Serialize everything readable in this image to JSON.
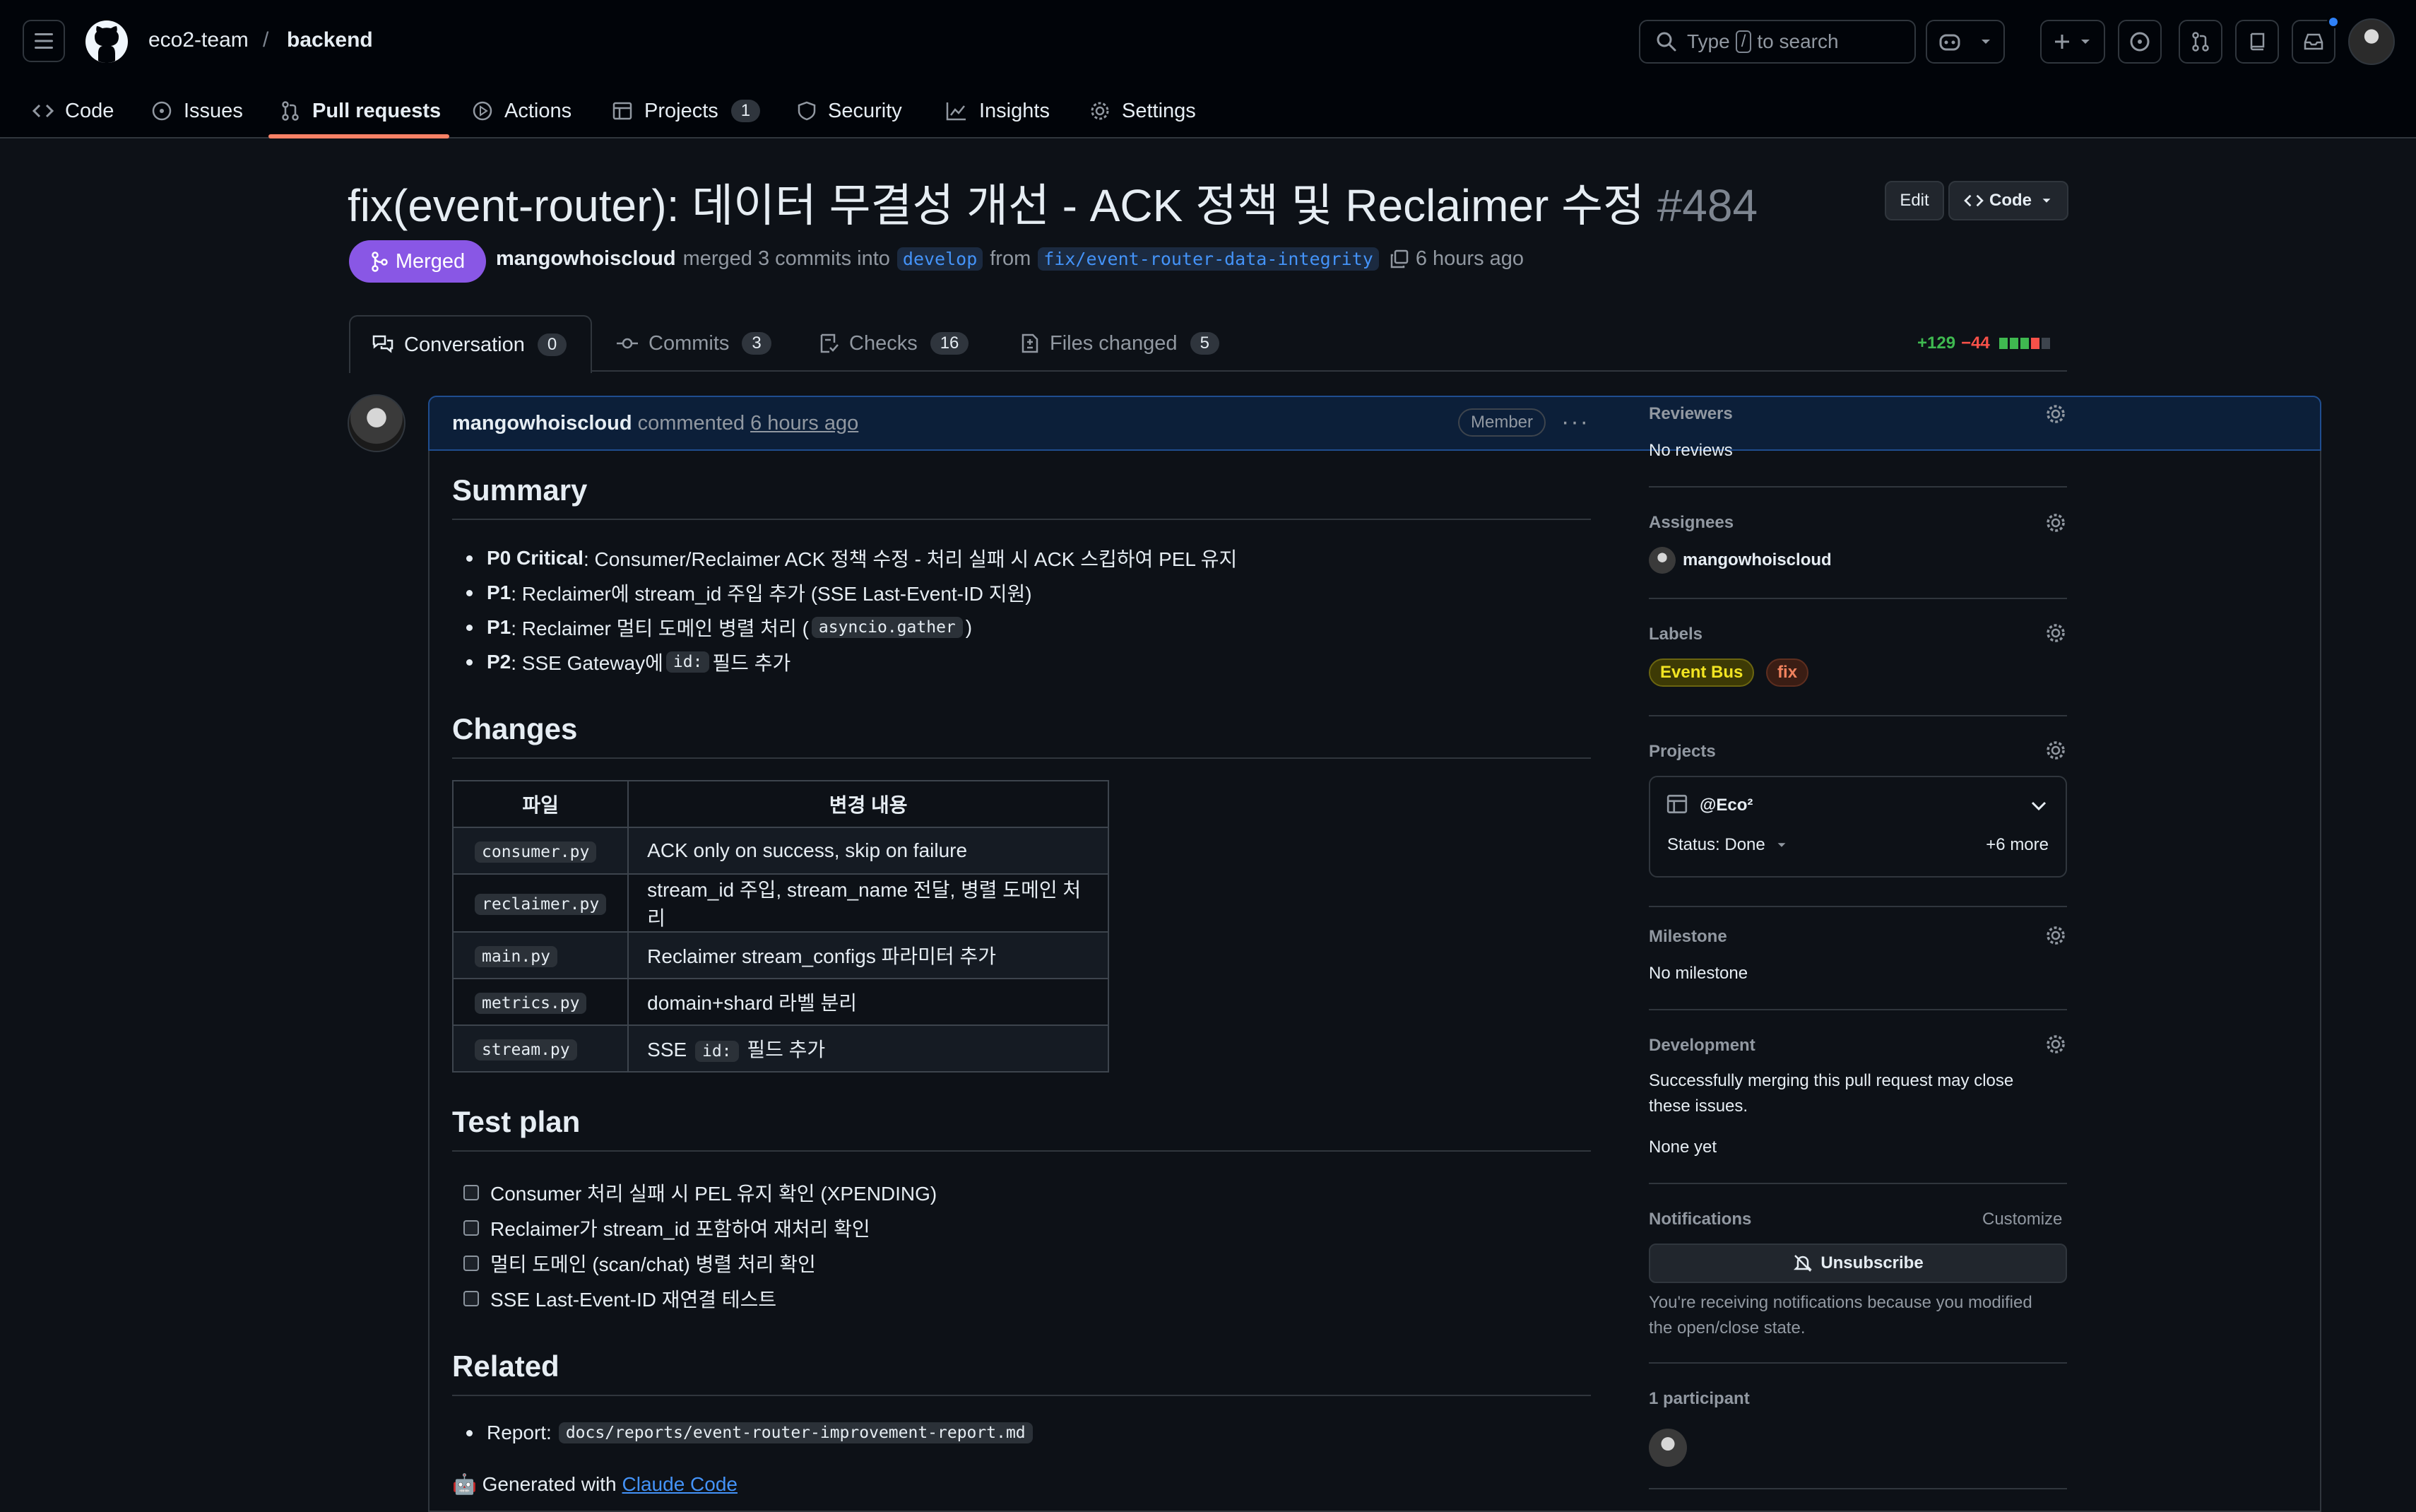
{
  "header": {
    "owner": "eco2-team",
    "separator": "/",
    "repo": "backend",
    "search_prefix": "Type",
    "search_key": "/",
    "search_suffix": "to search"
  },
  "repo_nav": [
    {
      "label": "Code"
    },
    {
      "label": "Issues"
    },
    {
      "label": "Pull requests"
    },
    {
      "label": "Actions"
    },
    {
      "label": "Projects",
      "count": "1"
    },
    {
      "label": "Security"
    },
    {
      "label": "Insights"
    },
    {
      "label": "Settings"
    }
  ],
  "pr": {
    "title": "fix(event-router): 데이터 무결성 개선 - ACK 정책 및 Reclaimer 수정",
    "number": "#484",
    "edit_label": "Edit",
    "code_label": "Code",
    "state": "Merged",
    "author": "mangowhoiscloud",
    "merged_text": "merged 3 commits into",
    "base_branch": "develop",
    "from_text": "from",
    "head_branch": "fix/event-router-data-integrity",
    "time": "6 hours ago"
  },
  "tabs": [
    {
      "label": "Conversation",
      "count": "0"
    },
    {
      "label": "Commits",
      "count": "3"
    },
    {
      "label": "Checks",
      "count": "16"
    },
    {
      "label": "Files changed",
      "count": "5"
    }
  ],
  "diffstat": {
    "additions": "+129",
    "deletions": "−44"
  },
  "colors": {
    "merged": "#8957e5",
    "link": "#4493f8",
    "add": "#3fb950",
    "del": "#f85149",
    "tab_underline": "#f78166"
  },
  "comment": {
    "author": "mangowhoiscloud",
    "action": "commented",
    "time": "6 hours ago",
    "role": "Member",
    "menu": "···",
    "summary_heading": "Summary",
    "summary": [
      {
        "prefix": "P0 Critical",
        "text": ": Consumer/Reclaimer ACK 정책 수정 - 처리 실패 시 ACK 스킵하여 PEL 유지"
      },
      {
        "prefix": "P1",
        "text": ": Reclaimer에 stream_id 주입 추가 (SSE Last-Event-ID 지원)"
      },
      {
        "prefix": "P1",
        "text": ": Reclaimer 멀티 도메인 병렬 처리 (",
        "code": "asyncio.gather",
        "after": ")"
      },
      {
        "prefix": "P2",
        "text": ": SSE Gateway에",
        "code": "id:",
        "after": "필드 추가"
      }
    ],
    "changes_heading": "Changes",
    "table_headers": [
      "파일",
      "변경 내용"
    ],
    "table_rows": [
      {
        "file": "consumer.py",
        "desc": "ACK only on success, skip on failure"
      },
      {
        "file": "reclaimer.py",
        "desc": "stream_id 주입, stream_name 전달, 병렬 도메인 처리"
      },
      {
        "file": "main.py",
        "desc": "Reclaimer stream_configs 파라미터 추가"
      },
      {
        "file": "metrics.py",
        "desc": "domain+shard 라벨 분리"
      },
      {
        "file": "stream.py",
        "desc_before": "SSE",
        "desc_code": "id:",
        "desc_after": "필드 추가"
      }
    ],
    "test_heading": "Test plan",
    "test_items": [
      "Consumer 처리 실패 시 PEL 유지 확인 (XPENDING)",
      "Reclaimer가 stream_id 포함하여 재처리 확인",
      "멀티 도메인 (scan/chat) 병렬 처리 확인",
      "SSE Last-Event-ID 재연결 테스트"
    ],
    "related_heading": "Related",
    "report_label": "Report:",
    "report_path": "docs/reports/event-router-improvement-report.md",
    "generated_prefix": "🤖 Generated with",
    "generated_link": "Claude Code"
  },
  "sidebar": {
    "reviewers": {
      "title": "Reviewers",
      "value": "No reviews"
    },
    "assignees": {
      "title": "Assignees",
      "value": "mangowhoiscloud"
    },
    "labels": {
      "title": "Labels",
      "items": [
        {
          "name": "Event Bus",
          "bg": "#3d3a05",
          "fg": "#f2e422",
          "border": "#6b6510"
        },
        {
          "name": "fix",
          "bg": "#3a1d14",
          "fg": "#f0825e",
          "border": "#5e2e1f"
        }
      ]
    },
    "projects": {
      "title": "Projects",
      "name": "@Eco²",
      "status": "Status: Done",
      "more": "+6 more"
    },
    "milestone": {
      "title": "Milestone",
      "value": "No milestone"
    },
    "development": {
      "title": "Development",
      "line1": "Successfully merging this pull request may close",
      "line2": "these issues.",
      "value": "None yet"
    },
    "notifications": {
      "title": "Notifications",
      "customize": "Customize",
      "button": "Unsubscribe",
      "line1": "You're receiving notifications because you modified",
      "line2": "the open/close state."
    },
    "participants": {
      "title": "1 participant"
    }
  }
}
